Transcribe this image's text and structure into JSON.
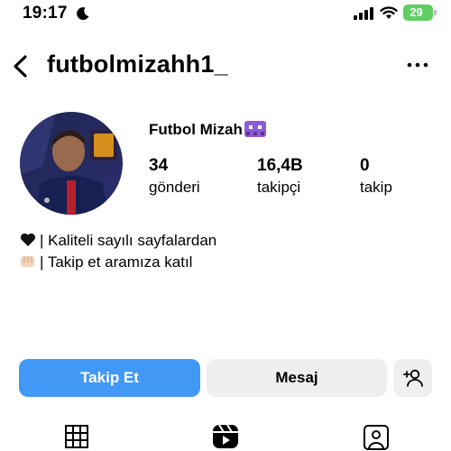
{
  "status_bar": {
    "time": "19:17",
    "battery": "29",
    "battery_color": "#5fcf63"
  },
  "header": {
    "username": "futbolmizahh1_",
    "back_icon": "chevron-left-icon",
    "more_icon": "ellipsis-icon"
  },
  "profile": {
    "display_name": "Futbol Mizah",
    "display_name_emoji": "space-invader-emoji",
    "stats": [
      {
        "value": "34",
        "label": "gönderi"
      },
      {
        "value": "16,4B",
        "label": "takipçi"
      },
      {
        "value": "0",
        "label": "takip"
      }
    ],
    "bio": [
      {
        "emoji": "black-heart-emoji",
        "text": "| Kaliteli sayılı sayfalardan"
      },
      {
        "emoji": "fist-bump-emoji",
        "text": "| Takip et aramıza katıl"
      }
    ]
  },
  "actions": {
    "follow_label": "Takip Et",
    "message_label": "Mesaj",
    "suggest_icon": "add-person-icon",
    "accent_color": "#4298f5"
  },
  "tabs": [
    {
      "icon": "grid-icon"
    },
    {
      "icon": "reels-icon"
    },
    {
      "icon": "tagged-person-icon"
    }
  ]
}
